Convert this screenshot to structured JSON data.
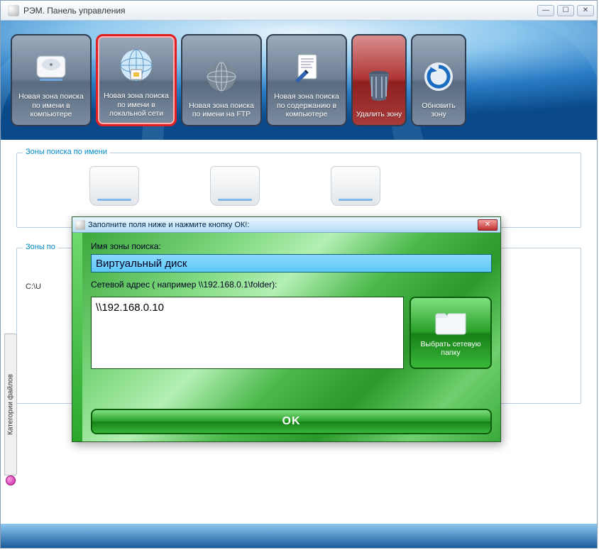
{
  "window": {
    "title": "РЭМ. Панель управления"
  },
  "ribbon": {
    "btn_local_computer": "Новая зона поиска по имени в компьютере",
    "btn_local_network": "Новая зона поиска по имени в локальной сети",
    "btn_ftp": "Новая зона поиска по имени на FTP",
    "btn_content": "Новая зона поиска по содержанию в компьютере",
    "btn_delete": "Удалить зону",
    "btn_refresh": "Обновить зону"
  },
  "sections": {
    "by_name": "Зоны поиска по имени",
    "by_other": "Зоны по",
    "categories_tab": "Категории файлов",
    "path_prefix": "C:\\U"
  },
  "dialog": {
    "title": "Заполните поля ниже и нажмите кнопку ОК!:",
    "label_zone_name": "Имя зоны поиска:",
    "value_zone_name": "Виртуальный диск",
    "label_net_addr": "Сетевой адрес ( например \\\\192.168.0.1\\folder):",
    "value_net_addr": "\\\\192.168.0.10",
    "browse_label": "Выбрать сетевую папку",
    "ok_label": "OK"
  }
}
